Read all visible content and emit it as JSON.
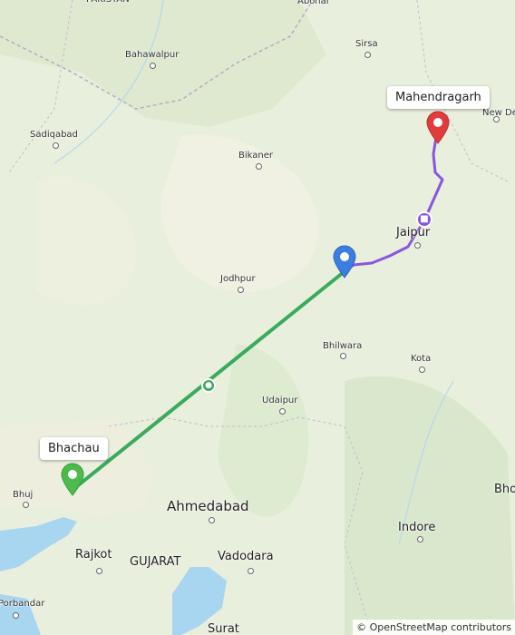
{
  "map": {
    "cities": [
      {
        "name": "PAKISTAN",
        "cls": "city"
      },
      {
        "name": "Abohar",
        "cls": "city"
      },
      {
        "name": "Sirsa",
        "cls": "city"
      },
      {
        "name": "Bahawalpur",
        "cls": "city"
      },
      {
        "name": "New De",
        "cls": "city"
      },
      {
        "name": "Sadiqabad",
        "cls": "city"
      },
      {
        "name": "Bikaner",
        "cls": "city"
      },
      {
        "name": "Jaipur",
        "cls": "city mid"
      },
      {
        "name": "Jodhpur",
        "cls": "city"
      },
      {
        "name": "Bhilwara",
        "cls": "city"
      },
      {
        "name": "Kota",
        "cls": "city"
      },
      {
        "name": "Udaipur",
        "cls": "city"
      },
      {
        "name": "Bhuj",
        "cls": "city"
      },
      {
        "name": "Ahmedabad",
        "cls": "city big"
      },
      {
        "name": "Indore",
        "cls": "city mid"
      },
      {
        "name": "Bho",
        "cls": "city mid"
      },
      {
        "name": "Rajkot",
        "cls": "city mid"
      },
      {
        "name": "GUJARAT",
        "cls": "city mid"
      },
      {
        "name": "Vadodara",
        "cls": "city mid"
      },
      {
        "name": "Porbandar",
        "cls": "city"
      },
      {
        "name": "Surat",
        "cls": "city mid"
      }
    ],
    "origin_label": "Bhachau",
    "destination_label": "Mahendragarh",
    "colors": {
      "green_route": "#3aaa5c",
      "purple_route": "#8a55e0",
      "origin_marker": "#4cbb4c",
      "waypoint_marker": "#3b7de0",
      "destination_marker": "#e23b3b",
      "water": "#a8d5f0"
    },
    "legs": [
      {
        "mode": "transit-icon"
      },
      {
        "mode": "car-icon"
      }
    ],
    "attribution": "© OpenStreetMap contributors"
  }
}
